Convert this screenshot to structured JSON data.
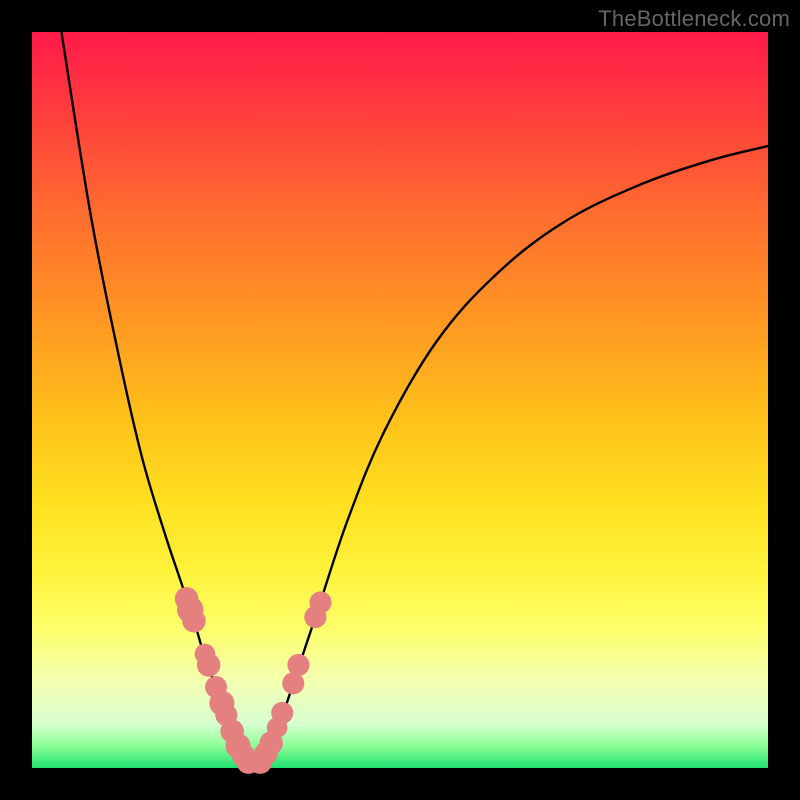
{
  "watermark": "TheBottleneck.com",
  "chart_data": {
    "type": "line",
    "title": "",
    "xlabel": "",
    "ylabel": "",
    "xlim": [
      0,
      100
    ],
    "ylim": [
      0,
      100
    ],
    "series": [
      {
        "name": "left-curve",
        "x": [
          4,
          8,
          12,
          15,
          18,
          20,
          22,
          23.5,
          25,
          26,
          27,
          28,
          28.8,
          29.5
        ],
        "y": [
          100,
          75,
          55,
          42,
          32,
          26,
          20,
          15,
          11,
          8,
          5,
          3,
          1.5,
          0.5
        ]
      },
      {
        "name": "right-curve",
        "x": [
          31,
          32.5,
          34,
          36,
          39,
          43,
          48,
          55,
          63,
          72,
          82,
          92,
          100
        ],
        "y": [
          0.5,
          3,
          7,
          13,
          22,
          34,
          46,
          58,
          67,
          74,
          79,
          82.5,
          84.5
        ]
      }
    ],
    "markers": [
      {
        "series": "left-curve",
        "x": 21.0,
        "y": 23.0,
        "r": 1.6
      },
      {
        "series": "left-curve",
        "x": 21.5,
        "y": 21.5,
        "r": 1.8
      },
      {
        "series": "left-curve",
        "x": 22.0,
        "y": 20.0,
        "r": 1.6
      },
      {
        "series": "left-curve",
        "x": 23.5,
        "y": 15.5,
        "r": 1.4
      },
      {
        "series": "left-curve",
        "x": 24.0,
        "y": 14.0,
        "r": 1.6
      },
      {
        "series": "left-curve",
        "x": 25.0,
        "y": 11.0,
        "r": 1.5
      },
      {
        "series": "left-curve",
        "x": 25.8,
        "y": 8.8,
        "r": 1.7
      },
      {
        "series": "left-curve",
        "x": 26.4,
        "y": 7.2,
        "r": 1.5
      },
      {
        "series": "left-curve",
        "x": 27.2,
        "y": 5.0,
        "r": 1.6
      },
      {
        "series": "left-curve",
        "x": 28.0,
        "y": 3.0,
        "r": 1.7
      },
      {
        "series": "left-curve",
        "x": 28.8,
        "y": 1.6,
        "r": 1.6
      },
      {
        "series": "left-curve",
        "x": 29.4,
        "y": 0.8,
        "r": 1.6
      },
      {
        "series": "right-curve",
        "x": 31.0,
        "y": 0.8,
        "r": 1.6
      },
      {
        "series": "right-curve",
        "x": 31.8,
        "y": 2.0,
        "r": 1.6
      },
      {
        "series": "right-curve",
        "x": 32.5,
        "y": 3.4,
        "r": 1.6
      },
      {
        "series": "right-curve",
        "x": 33.3,
        "y": 5.5,
        "r": 1.4
      },
      {
        "series": "right-curve",
        "x": 34.0,
        "y": 7.5,
        "r": 1.5
      },
      {
        "series": "right-curve",
        "x": 35.5,
        "y": 11.5,
        "r": 1.5
      },
      {
        "series": "right-curve",
        "x": 36.2,
        "y": 14.0,
        "r": 1.5
      },
      {
        "series": "right-curve",
        "x": 38.5,
        "y": 20.5,
        "r": 1.5
      },
      {
        "series": "right-curve",
        "x": 39.2,
        "y": 22.5,
        "r": 1.5
      }
    ],
    "colors": {
      "curve": "#000000",
      "marker": "#e58080"
    }
  }
}
